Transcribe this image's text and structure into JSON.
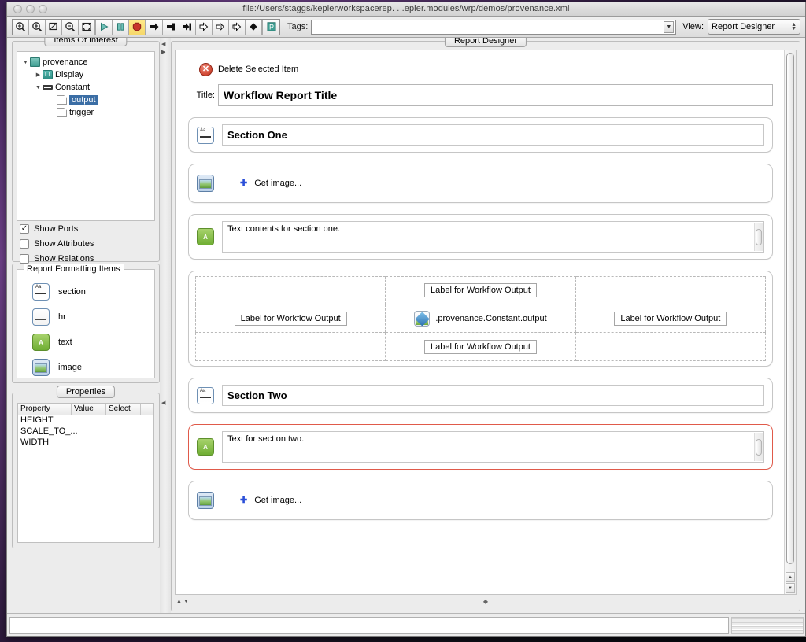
{
  "window": {
    "title": "file:/Users/staggs/keplerworkspacerep. . .epler.modules/wrp/demos/provenance.xml",
    "traffic_lights": [
      "close",
      "minimize",
      "zoom"
    ]
  },
  "toolbar": {
    "buttons": [
      {
        "name": "zoom-in-icon",
        "glyph": "zoom-in"
      },
      {
        "name": "zoom-reset-icon",
        "glyph": "zoom-reset"
      },
      {
        "name": "zoom-fit-icon",
        "glyph": "zoom-fit"
      },
      {
        "name": "zoom-out-icon",
        "glyph": "zoom-out"
      },
      {
        "name": "fullscreen-icon",
        "glyph": "fullscreen"
      },
      {
        "name": "run-icon",
        "glyph": "play"
      },
      {
        "name": "pause-icon",
        "glyph": "pause"
      },
      {
        "name": "stop-icon",
        "glyph": "stop",
        "highlighted": true
      },
      {
        "name": "step-icon",
        "glyph": "arrow-right"
      },
      {
        "name": "step-to-end-icon",
        "glyph": "arrow-flag"
      },
      {
        "name": "step-fat-icon",
        "glyph": "arrow-fat"
      },
      {
        "name": "hollow-arrow-1-icon",
        "glyph": "arrow-hollow"
      },
      {
        "name": "hollow-arrow-2-icon",
        "glyph": "arrow-hollow-2"
      },
      {
        "name": "hollow-arrow-3-icon",
        "glyph": "arrow-hollow-3"
      },
      {
        "name": "diamond-icon",
        "glyph": "diamond"
      },
      {
        "name": "provenance-icon",
        "glyph": "P"
      }
    ],
    "tags_label": "Tags:",
    "tags_value": "",
    "view_label": "View:",
    "view_value": "Report Designer",
    "accent_teal": "#2f8f86",
    "accent_red": "#c8342a",
    "highlight_yellow": "#f6d86a"
  },
  "sidebar": {
    "items_of_interest": {
      "tab": "Items Of Interest",
      "tree": [
        {
          "label": "provenance",
          "indent": 0,
          "twisty": "open",
          "icon": "folder-icon"
        },
        {
          "label": "Display",
          "indent": 1,
          "twisty": "closed",
          "icon": "tt-icon"
        },
        {
          "label": "Constant",
          "indent": 1,
          "twisty": "open",
          "icon": "constant-icon"
        },
        {
          "label": "output",
          "indent": 2,
          "twisty": "none",
          "icon": "port-icon",
          "selected": true
        },
        {
          "label": "trigger",
          "indent": 2,
          "twisty": "none",
          "icon": "port-icon",
          "selected": false
        }
      ],
      "checkboxes": [
        {
          "label": "Show Ports",
          "checked": true
        },
        {
          "label": "Show Attributes",
          "checked": false
        },
        {
          "label": "Show Relations",
          "checked": false
        }
      ]
    },
    "report_formatting": {
      "legend": "Report Formatting Items",
      "items": [
        {
          "label": "section",
          "icon": "section-icon"
        },
        {
          "label": "hr",
          "icon": "hr-icon"
        },
        {
          "label": "text",
          "icon": "text-icon"
        },
        {
          "label": "image",
          "icon": "image-icon"
        }
      ]
    },
    "properties": {
      "tab": "Properties",
      "columns": [
        "Property",
        "Value",
        "Select"
      ],
      "rows": [
        {
          "property": "HEIGHT",
          "value": "",
          "select": ""
        },
        {
          "property": "SCALE_TO_...",
          "value": "",
          "select": ""
        },
        {
          "property": "WIDTH",
          "value": "",
          "select": ""
        }
      ]
    }
  },
  "designer": {
    "tab": "Report Designer",
    "delete_label": "Delete Selected Item",
    "title_label": "Title:",
    "title_value": "Workflow Report Title",
    "blocks": [
      {
        "kind": "section",
        "icon": "section-icon",
        "value": "Section One",
        "selected": false
      },
      {
        "kind": "image",
        "icon": "image-icon",
        "value": "Get image...",
        "selected": false
      },
      {
        "kind": "text",
        "icon": "text-icon",
        "value": "Text contents for section one.",
        "selected": false
      },
      {
        "kind": "grid",
        "selected": false
      },
      {
        "kind": "section",
        "icon": "section-icon",
        "value": "Section Two",
        "selected": false
      },
      {
        "kind": "text",
        "icon": "text-icon",
        "value": "Text for section two.",
        "selected": true
      },
      {
        "kind": "image",
        "icon": "image-icon",
        "value": "Get image...",
        "selected": false
      }
    ],
    "grid": {
      "cells": [
        [
          "",
          "Label for Workflow Output",
          ""
        ],
        [
          "Label for Workflow Output",
          ".provenance.Constant.output",
          "Label for Workflow Output"
        ],
        [
          "",
          "Label for Workflow Output",
          ""
        ]
      ],
      "output_icon": "workflow-output-icon",
      "output_cell_row": 1,
      "output_cell_col": 1
    },
    "selection_color": "#e05a4a"
  },
  "statusbar": {
    "message": ""
  }
}
